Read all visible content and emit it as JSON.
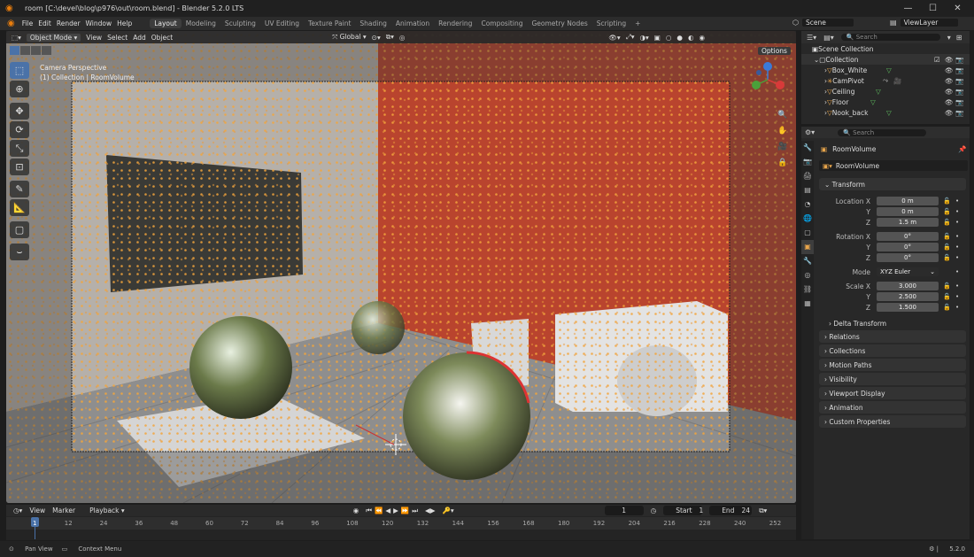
{
  "window": {
    "title": "room [C:\\devel\\blog\\p976\\out\\room.blend] - Blender 5.2.0 LTS"
  },
  "menu": [
    "File",
    "Edit",
    "Render",
    "Window",
    "Help"
  ],
  "workspaces": [
    "Layout",
    "Modeling",
    "Sculpting",
    "UV Editing",
    "Texture Paint",
    "Shading",
    "Animation",
    "Rendering",
    "Compositing",
    "Geometry Nodes",
    "Scripting"
  ],
  "topright": {
    "scene": "Scene",
    "viewlayer": "ViewLayer"
  },
  "viewport": {
    "mode": "Object Mode",
    "menus": [
      "View",
      "Select",
      "Add",
      "Object"
    ],
    "transform_orientation": "Global",
    "options": "Options",
    "overlay_line1": "Camera Perspective",
    "overlay_line2": "(1) Collection | RoomVolume"
  },
  "timeline": {
    "menus": [
      "View",
      "Marker",
      "Playback"
    ],
    "current_frame": "1",
    "start_label": "Start",
    "start": "1",
    "end_label": "End",
    "end": "24",
    "ticks": [
      "1",
      "12",
      "24",
      "36",
      "48",
      "60",
      "72",
      "84",
      "96",
      "108",
      "120",
      "132",
      "144",
      "156",
      "168",
      "180",
      "192",
      "204",
      "216",
      "228",
      "240",
      "252"
    ]
  },
  "status": {
    "left1": "Pan View",
    "left2": "Context Menu",
    "version": "5.2.0"
  },
  "outliner": {
    "search_placeholder": "Search",
    "root": "Scene Collection",
    "collection": "Collection",
    "items": [
      "Box_White",
      "CamPivot",
      "Ceiling",
      "Floor",
      "Nook_back"
    ]
  },
  "properties": {
    "search_placeholder": "Search",
    "object_name": "RoomVolume",
    "data_name": "RoomVolume",
    "transform_label": "Transform",
    "location": {
      "label": "Location X",
      "x": "0 m",
      "y": "0 m",
      "z": "1.5 m"
    },
    "rotation": {
      "label": "Rotation X",
      "x": "0°",
      "y": "0°",
      "z": "0°"
    },
    "mode_label": "Mode",
    "mode_value": "XYZ Euler",
    "scale": {
      "label": "Scale X",
      "x": "3.000",
      "y": "2.500",
      "z": "1.500"
    },
    "axis_y": "Y",
    "axis_z": "Z",
    "delta": "Delta Transform",
    "sections": [
      "Relations",
      "Collections",
      "Motion Paths",
      "Visibility",
      "Viewport Display",
      "Animation",
      "Custom Properties"
    ]
  }
}
